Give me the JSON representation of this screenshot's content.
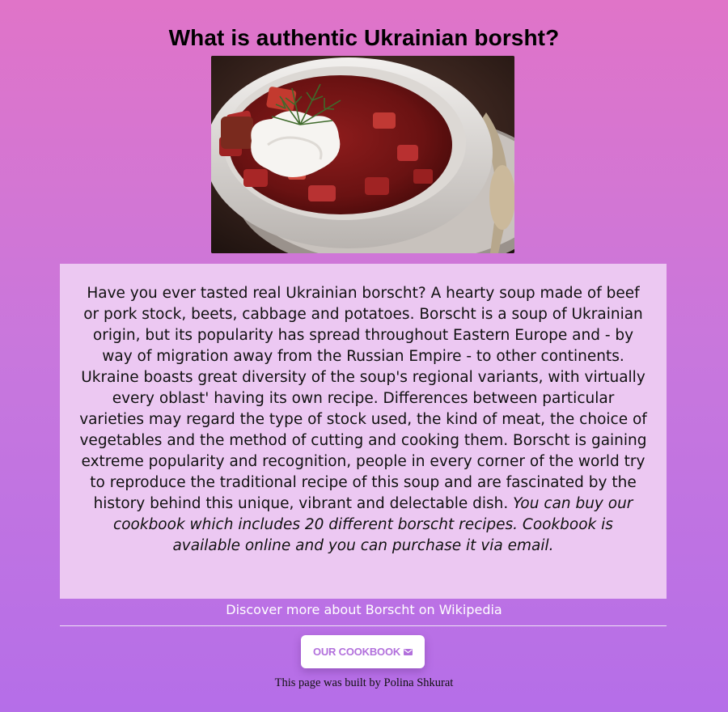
{
  "page": {
    "title": "What is authentic Ukrainian borsht?"
  },
  "image": {
    "alt": "Bowl of borscht with sour cream and dill"
  },
  "article": {
    "text": "Have you ever tasted real Ukrainian borscht? A hearty soup made of beef or pork stock, beets, cabbage and potatoes. Borscht is a soup of Ukrainian origin, but its popularity has spread throughout Eastern Europe and - by way of migration away from the Russian Empire - to other continents. Ukraine boasts great diversity of the soup's regional variants, with virtually every oblast' having its own recipe. Differences between particular varieties may regard the type of stock used, the kind of meat, the choice of vegetables and the method of cutting and cooking them. Borscht is gaining extreme popularity and recognition, people in every corner of the world try to reproduce the traditional recipe of this soup and are fascinated by the history behind this unique, vibrant and delectable dish.",
    "italic_text": "You can buy our cookbook which includes 20 different borscht recipes. Cookbook is available online and you can purchase it via email."
  },
  "links": {
    "wikipedia": "Discover more about Borscht on Wikipedia"
  },
  "button": {
    "label": "OUR COOKBOOK",
    "icon": "envelope-icon"
  },
  "footer": {
    "text": "This page was built by Polina Shkurat"
  },
  "colors": {
    "gradient_top": "#e074c8",
    "gradient_bottom": "#b56ee8",
    "card_background": "#ecc8f2",
    "button_text": "#b270dc"
  }
}
